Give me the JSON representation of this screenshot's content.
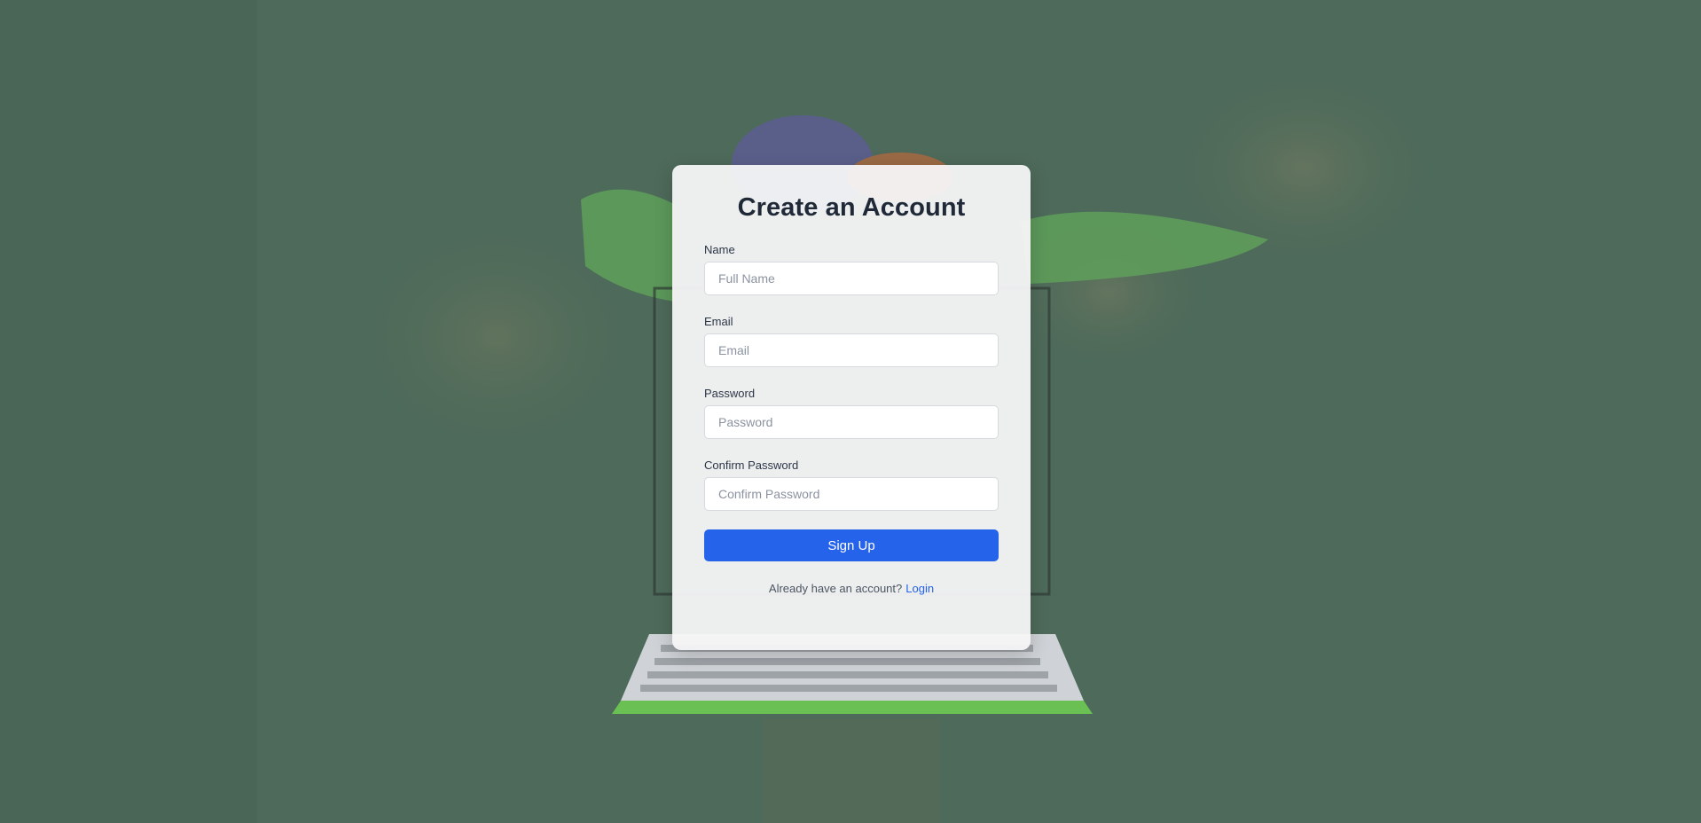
{
  "signup": {
    "title": "Create an Account",
    "fields": [
      {
        "label": "Name",
        "placeholder": "Full Name",
        "value": ""
      },
      {
        "label": "Email",
        "placeholder": "Email",
        "value": ""
      },
      {
        "label": "Password",
        "placeholder": "Password",
        "value": ""
      },
      {
        "label": "Confirm Password",
        "placeholder": "Confirm Password",
        "value": ""
      }
    ],
    "submit_label": "Sign Up",
    "login_prompt": "Already have an account?",
    "login_link": "Login"
  },
  "colors": {
    "accent": "#2563eb",
    "background": "#4e6a5a",
    "card": "#f6f6f7"
  }
}
